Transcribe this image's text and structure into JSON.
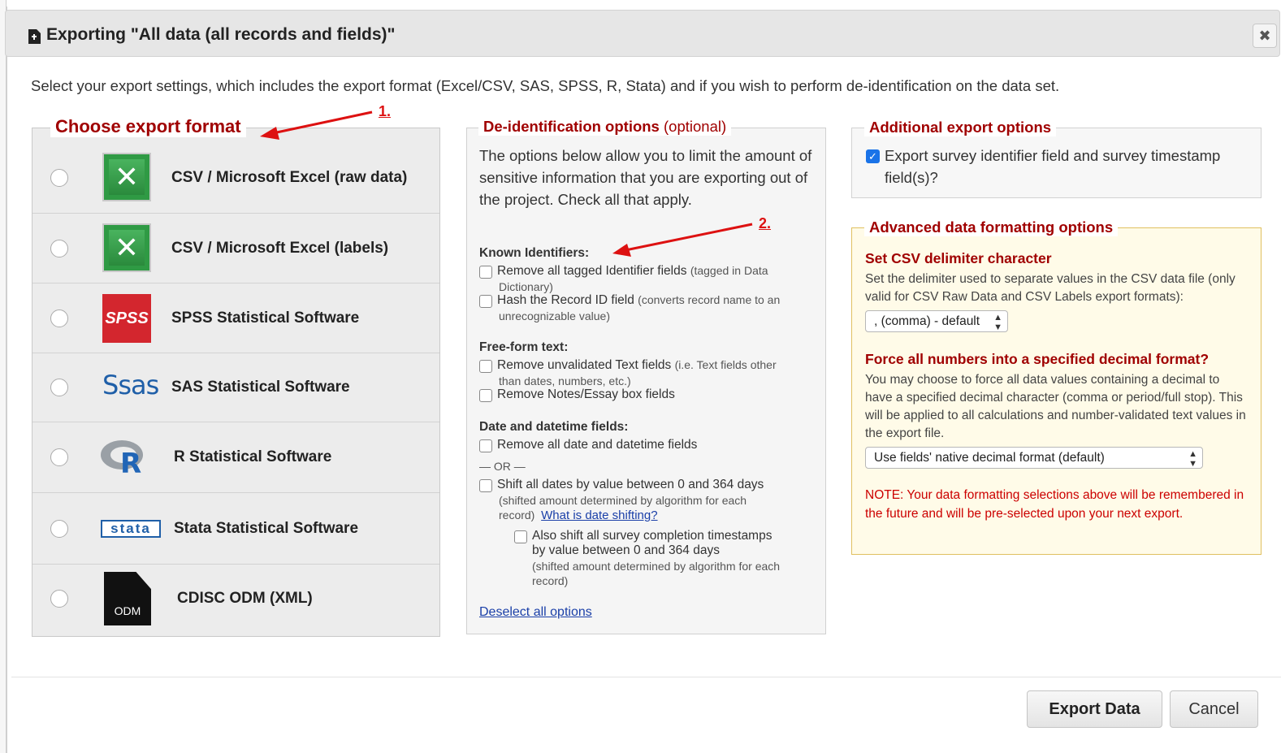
{
  "dialog": {
    "title": "Exporting \"All data (all records and fields)\"",
    "close_label": "✖",
    "intro": "Select your export settings, which includes the export format (Excel/CSV, SAS, SPSS, R, Stata) and if you wish to perform de-identification on the data set."
  },
  "formats": {
    "legend": "Choose export format",
    "items": [
      {
        "label": "CSV / Microsoft Excel (raw data)",
        "icon": "excel-icon"
      },
      {
        "label": "CSV / Microsoft Excel (labels)",
        "icon": "excel-icon"
      },
      {
        "label": "SPSS Statistical Software",
        "icon": "spss-icon",
        "icon_text": "SPSS"
      },
      {
        "label": "SAS Statistical Software",
        "icon": "sas-icon",
        "icon_text": "Ssas"
      },
      {
        "label": "R Statistical Software",
        "icon": "r-icon",
        "icon_text": "R"
      },
      {
        "label": "Stata Statistical Software",
        "icon": "stata-icon",
        "icon_text": "stata"
      },
      {
        "label": "CDISC ODM (XML)",
        "icon": "odm-file-icon",
        "icon_text": "ODM"
      }
    ]
  },
  "deid": {
    "legend_strong": "De-identification options",
    "legend_optional": "(optional)",
    "intro": "The options below allow you to limit the amount of sensitive information that you are exporting out of the project. Check all that apply.",
    "known_identifiers": {
      "heading": "Known Identifiers:",
      "remove_tagged": "Remove all tagged Identifier fields",
      "remove_tagged_note": "(tagged in Data",
      "remove_tagged_note2": "Dictionary)",
      "hash_record": "Hash the Record ID field",
      "hash_record_note": "(converts record name to an",
      "hash_record_note2": "unrecognizable value)"
    },
    "free_form": {
      "heading": "Free-form text:",
      "remove_unvalidated": "Remove unvalidated Text fields",
      "remove_unvalidated_note": "(i.e. Text fields other",
      "remove_unvalidated_note2": "than dates, numbers, etc.)",
      "remove_notes": "Remove Notes/Essay box fields"
    },
    "dates": {
      "heading": "Date and datetime fields:",
      "remove_all": "Remove all date and datetime fields",
      "or": "— OR —",
      "shift": "Shift all dates by value between 0 and 364 days",
      "shift_note": "(shifted amount determined by algorithm for each",
      "shift_note2": "record)",
      "shift_link": "What is date shifting?",
      "also_shift": "Also shift all survey completion timestamps",
      "also_shift2": "by value between 0 and 364 days",
      "also_shift_note": "(shifted amount determined by algorithm for each",
      "also_shift_note2": "record)"
    },
    "deselect": "Deselect all options"
  },
  "additional": {
    "legend": "Additional export options",
    "checkbox_label": "Export survey identifier field and survey timestamp field(s)?",
    "checked": true
  },
  "advanced": {
    "legend": "Advanced data formatting options",
    "csv_heading": "Set CSV delimiter character",
    "csv_desc": "Set the delimiter used to separate values in the CSV data file (only valid for CSV Raw Data and CSV Labels export formats):",
    "csv_selected": ", (comma) - default",
    "decimal_heading": "Force all numbers into a specified decimal format?",
    "decimal_desc": "You may choose to force all data values containing a decimal to have a specified decimal character (comma or period/full stop). This will be applied to all calculations and number-validated text values in the export file.",
    "decimal_selected": "Use fields' native decimal format (default)",
    "note": "NOTE: Your data formatting selections above will be remembered in the future and will be pre-selected upon your next export."
  },
  "footer": {
    "export_label": "Export Data",
    "cancel_label": "Cancel"
  },
  "annotations": {
    "one": "1.",
    "two": "2.",
    "color": "#dd1111"
  }
}
